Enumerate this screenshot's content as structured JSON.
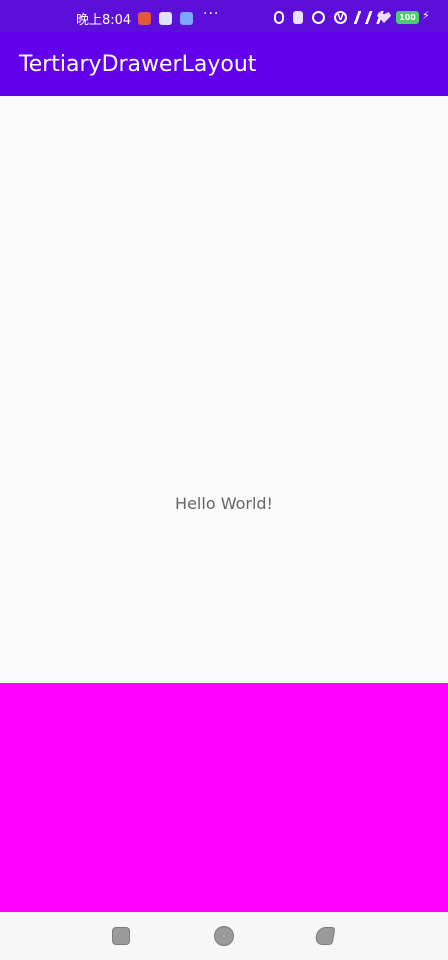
{
  "status_bar": {
    "time": "晚上8:04",
    "more_icons": "···",
    "vpn_label": "V",
    "battery_level": "100"
  },
  "app_bar": {
    "title": "TertiaryDrawerLayout"
  },
  "main": {
    "hello_text": "Hello World!"
  },
  "colors": {
    "status_bar": "#5c0fd8",
    "app_bar": "#6200ee",
    "content_background": "#fafafa",
    "drawer_panel": "#ff00ff",
    "hello_text": "#666666",
    "navigation_bar": "#f7f7f7"
  },
  "icons": {
    "notification_1": "red-app-icon",
    "notification_2": "light-app-icon",
    "notification_3": "blue-app-icon",
    "bluetooth": "bluetooth-icon",
    "vibrate": "vibrate-icon",
    "alarm": "alarm-icon",
    "vpn": "vpn-icon",
    "signal": "signal-icon",
    "wifi": "wifi-icon",
    "battery": "battery-icon",
    "charge": "charging-icon",
    "back": "back-icon",
    "home": "home-icon",
    "recent": "recent-apps-icon"
  }
}
